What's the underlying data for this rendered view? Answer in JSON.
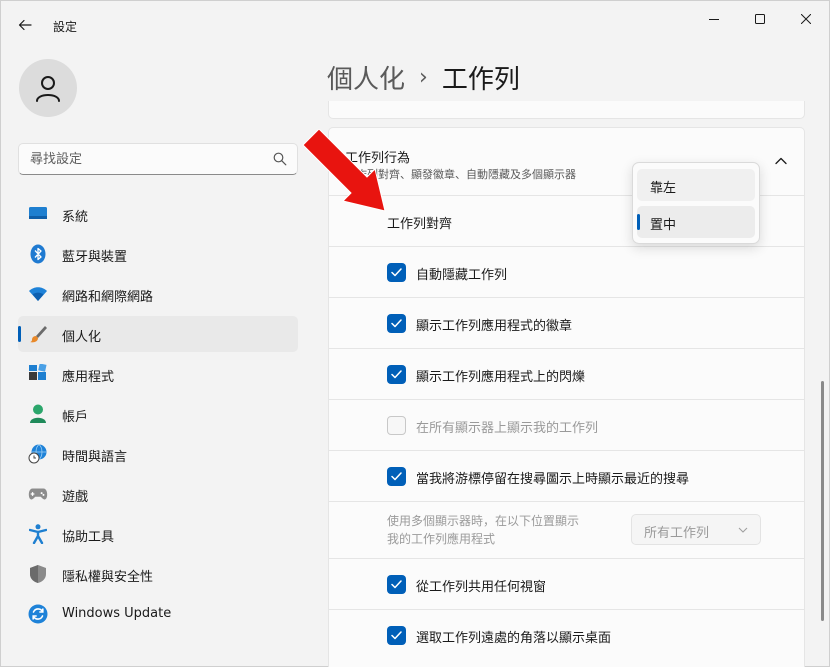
{
  "window": {
    "app_title": "設定",
    "controls": [
      "minimize",
      "maximize",
      "close"
    ]
  },
  "sidebar": {
    "search": {
      "placeholder": "尋找設定",
      "value": ""
    },
    "items": [
      {
        "label": "系統",
        "icon": "monitor-icon",
        "active": false
      },
      {
        "label": "藍牙與裝置",
        "icon": "bluetooth-icon",
        "active": false
      },
      {
        "label": "網路和網際網路",
        "icon": "wifi-icon",
        "active": false
      },
      {
        "label": "個人化",
        "icon": "brush-icon",
        "active": true
      },
      {
        "label": "應用程式",
        "icon": "apps-icon",
        "active": false
      },
      {
        "label": "帳戶",
        "icon": "person-icon",
        "active": false
      },
      {
        "label": "時間與語言",
        "icon": "globe-clock-icon",
        "active": false
      },
      {
        "label": "遊戲",
        "icon": "gamepad-icon",
        "active": false
      },
      {
        "label": "協助工具",
        "icon": "accessibility-icon",
        "active": false
      },
      {
        "label": "隱私權與安全性",
        "icon": "shield-icon",
        "active": false
      },
      {
        "label": "Windows Update",
        "icon": "update-icon",
        "active": false
      }
    ]
  },
  "header": {
    "breadcrumb_parent": "個人化",
    "breadcrumb_separator": "›",
    "breadcrumb_current": "工作列"
  },
  "taskbar_behaviors": {
    "title": "工作列行為",
    "subtitle": "工作列對齊、顯發徽章、自動隱藏及多個顯示器",
    "alignment": {
      "label": "工作列對齊",
      "options": [
        "靠左",
        "置中"
      ],
      "selected": "置中"
    },
    "auto_hide": {
      "label": "自動隱藏工作列",
      "checked": true
    },
    "show_badges": {
      "label": "顯示工作列應用程式的徽章",
      "checked": true
    },
    "show_flashing": {
      "label": "顯示工作列應用程式上的閃爍",
      "checked": true
    },
    "all_displays": {
      "label": "在所有顯示器上顯示我的工作列",
      "checked": false,
      "disabled": true
    },
    "search_hover": {
      "label": "當我將游標停留在搜尋圖示上時顯示最近的搜尋",
      "checked": true
    },
    "multi_display": {
      "label_line1": "使用多個顯示器時，在以下位置顯示",
      "label_line2": "我的工作列應用程式",
      "value": "所有工作列",
      "disabled": true
    },
    "share_window": {
      "label": "從工作列共用任何視窗",
      "checked": true
    },
    "far_corner": {
      "label": "選取工作列遠處的角落以顯示桌面",
      "checked": true
    }
  },
  "colors": {
    "accent": "#005fb8",
    "annotation_arrow": "#e8140f"
  }
}
